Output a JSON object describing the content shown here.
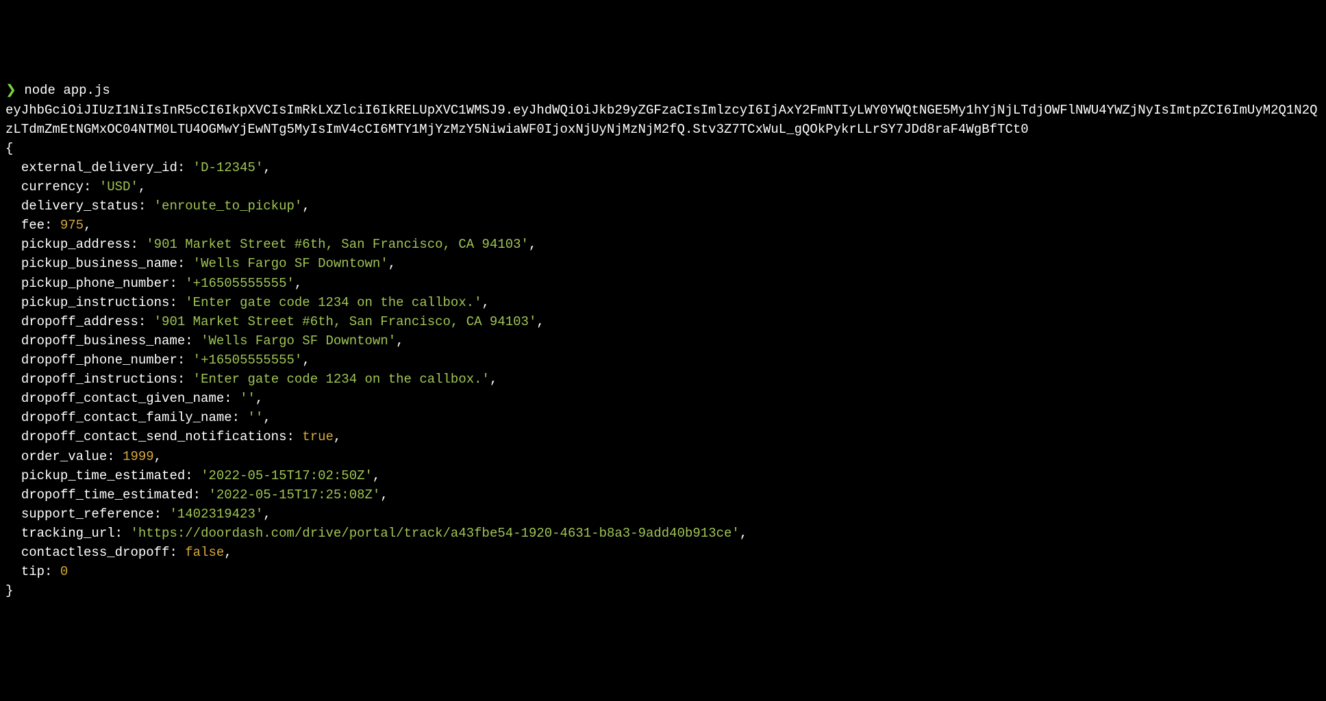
{
  "prompt_symbol": "❯",
  "command": "node app.js",
  "jwt_token": "eyJhbGciOiJIUzI1NiIsInR5cCI6IkpXVCIsImRkLXZlciI6IkRELUpXVC1WMSJ9.eyJhdWQiOiJkb29yZGFzaCIsImlzcyI6IjAxY2FmNTIyLWY0YWQtNGE5My1hYjNjLTdjOWFlNWU4YWZjNyIsImtpZCI6ImUyM2Q1N2QzLTdmZmEtNGMxOC04NTM0LTU4OGMwYjEwNTg5MyIsImV4cCI6MTY1MjYzMzY5NiwiaWF0IjoxNjUyNjMzNjM2fQ.Stv3Z7TCxWuL_gQOkPykrLLrSY7JDd8raF4WgBfTCt0",
  "obj": {
    "open": "{",
    "close": "}",
    "fields": [
      {
        "key": "external_delivery_id",
        "type": "str",
        "value": "'D-12345'",
        "comma": ","
      },
      {
        "key": "currency",
        "type": "str",
        "value": "'USD'",
        "comma": ","
      },
      {
        "key": "delivery_status",
        "type": "str",
        "value": "'enroute_to_pickup'",
        "comma": ","
      },
      {
        "key": "fee",
        "type": "num",
        "value": "975",
        "comma": ","
      },
      {
        "key": "pickup_address",
        "type": "str",
        "value": "'901 Market Street #6th, San Francisco, CA 94103'",
        "comma": ","
      },
      {
        "key": "pickup_business_name",
        "type": "str",
        "value": "'Wells Fargo SF Downtown'",
        "comma": ","
      },
      {
        "key": "pickup_phone_number",
        "type": "str",
        "value": "'+16505555555'",
        "comma": ","
      },
      {
        "key": "pickup_instructions",
        "type": "str",
        "value": "'Enter gate code 1234 on the callbox.'",
        "comma": ","
      },
      {
        "key": "dropoff_address",
        "type": "str",
        "value": "'901 Market Street #6th, San Francisco, CA 94103'",
        "comma": ","
      },
      {
        "key": "dropoff_business_name",
        "type": "str",
        "value": "'Wells Fargo SF Downtown'",
        "comma": ","
      },
      {
        "key": "dropoff_phone_number",
        "type": "str",
        "value": "'+16505555555'",
        "comma": ","
      },
      {
        "key": "dropoff_instructions",
        "type": "str",
        "value": "'Enter gate code 1234 on the callbox.'",
        "comma": ","
      },
      {
        "key": "dropoff_contact_given_name",
        "type": "str",
        "value": "''",
        "comma": ","
      },
      {
        "key": "dropoff_contact_family_name",
        "type": "str",
        "value": "''",
        "comma": ","
      },
      {
        "key": "dropoff_contact_send_notifications",
        "type": "bool",
        "value": "true",
        "comma": ","
      },
      {
        "key": "order_value",
        "type": "num",
        "value": "1999",
        "comma": ","
      },
      {
        "key": "pickup_time_estimated",
        "type": "str",
        "value": "'2022-05-15T17:02:50Z'",
        "comma": ","
      },
      {
        "key": "dropoff_time_estimated",
        "type": "str",
        "value": "'2022-05-15T17:25:08Z'",
        "comma": ","
      },
      {
        "key": "support_reference",
        "type": "str",
        "value": "'1402319423'",
        "comma": ","
      },
      {
        "key": "tracking_url",
        "type": "str",
        "value": "'https://doordash.com/drive/portal/track/a43fbe54-1920-4631-b8a3-9add40b913ce'",
        "comma": ","
      },
      {
        "key": "contactless_dropoff",
        "type": "bool",
        "value": "false",
        "comma": ","
      },
      {
        "key": "tip",
        "type": "num",
        "value": "0",
        "comma": ""
      }
    ]
  }
}
